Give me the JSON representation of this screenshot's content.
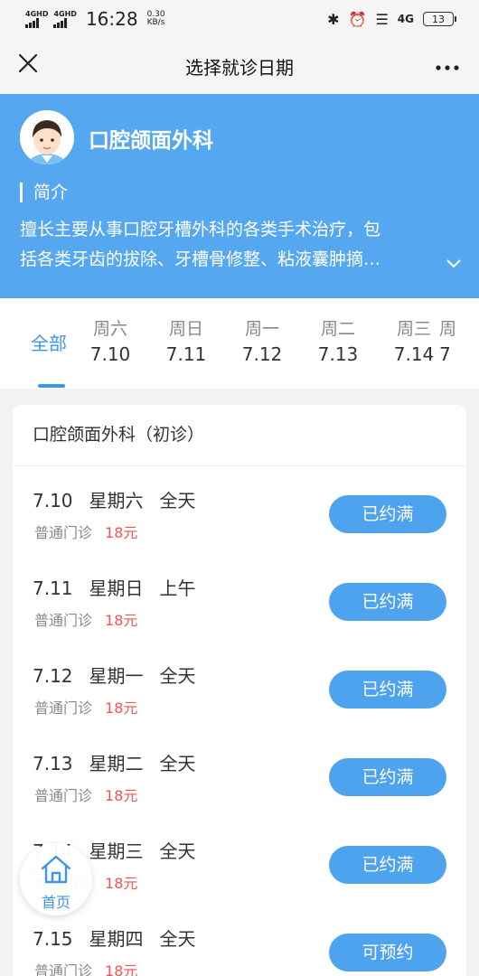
{
  "status_bar": {
    "net1": "4GHD",
    "net2": "4GHD",
    "time": "16:28",
    "speed_value": "0.30",
    "speed_unit": "KB/s",
    "net3": "4G",
    "battery": "13",
    "icons": [
      "bluetooth-icon",
      "alarm-icon",
      "vibrate-icon"
    ]
  },
  "title_bar": {
    "title": "选择就诊日期",
    "close_icon": "close-icon",
    "more_icon": "more-icon"
  },
  "department": {
    "name": "口腔颌面外科",
    "intro_label": "简介",
    "intro_line1": "擅长主要从事口腔牙槽外科的各类手术治疗，包",
    "intro_line2": "括各类牙齿的拔除、牙槽骨修整、粘液囊肿摘…",
    "header_color": "#55a8f0"
  },
  "tabs": {
    "all_label": "全部",
    "days": [
      {
        "weekday": "周六",
        "date": "7.10"
      },
      {
        "weekday": "周日",
        "date": "7.11"
      },
      {
        "weekday": "周一",
        "date": "7.12"
      },
      {
        "weekday": "周二",
        "date": "7.13"
      },
      {
        "weekday": "周三",
        "date": "7.14"
      },
      {
        "weekday": "周",
        "date": "7"
      }
    ]
  },
  "schedule": {
    "title": "口腔颌面外科（初诊）",
    "slots": [
      {
        "date": "7.10",
        "weekday": "星期六",
        "period": "全天",
        "type": "普通门诊",
        "price": "18元",
        "status": "已约满"
      },
      {
        "date": "7.11",
        "weekday": "星期日",
        "period": "上午",
        "type": "普通门诊",
        "price": "18元",
        "status": "已约满"
      },
      {
        "date": "7.12",
        "weekday": "星期一",
        "period": "全天",
        "type": "普通门诊",
        "price": "18元",
        "status": "已约满"
      },
      {
        "date": "7.13",
        "weekday": "星期二",
        "period": "全天",
        "type": "普通门诊",
        "price": "18元",
        "status": "已约满"
      },
      {
        "date": "7.14",
        "weekday": "星期三",
        "period": "全天",
        "type": "普通门诊",
        "price": "18元",
        "status": "已约满"
      },
      {
        "date": "7.15",
        "weekday": "星期四",
        "period": "全天",
        "type": "普通门诊",
        "price": "18元",
        "status": "可预约"
      }
    ]
  },
  "home_button": {
    "label": "首页"
  },
  "colors": {
    "accent": "#3f95e6",
    "button": "#4ea3ee",
    "price": "#f05454"
  }
}
